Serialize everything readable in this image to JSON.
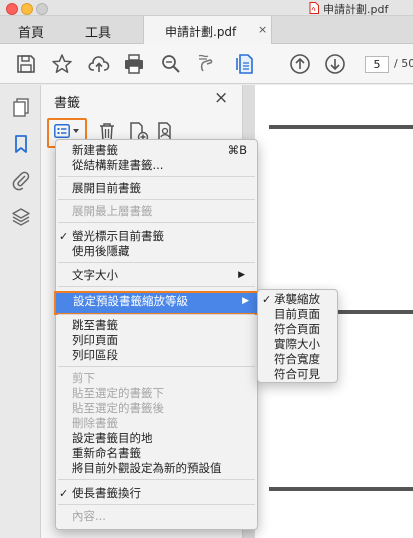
{
  "window": {
    "doc_title": "申請計劃.pdf"
  },
  "tabs": {
    "home": "首頁",
    "tools": "工具",
    "document": "申請計劃.pdf",
    "close": "×"
  },
  "toolbar": {
    "page_current": "5",
    "page_total": "/ 50"
  },
  "panel": {
    "title": "書籤",
    "close": "×"
  },
  "menu": {
    "new_bookmark": "新建書籤",
    "new_bookmark_shortcut": "⌘B",
    "new_from_structure": "從結構新建書籤...",
    "expand_current": "展開目前書籤",
    "expand_top_level": "展開最上層書籤",
    "highlight_current": "螢光標示目前書籤",
    "hide_after_use": "使用後隱藏",
    "text_size": "文字大小",
    "default_zoom": "設定預設書籤縮放等級",
    "goto": "跳至書籤",
    "print_pages": "列印頁面",
    "print_sections": "列印區段",
    "cut": "剪下",
    "paste_under": "貼至選定的書籤下",
    "paste_after": "貼至選定的書籤後",
    "delete": "刪除書籤",
    "set_destination": "設定書籤目的地",
    "rename": "重新命名書籤",
    "set_appearance_default": "將目前外觀設定為新的預設值",
    "wrap_long": "使長書籤換行",
    "properties": "內容...",
    "check": "✓",
    "arrow": "▶"
  },
  "submenu": {
    "items": [
      "承襲縮放",
      "目前頁面",
      "符合頁面",
      "實際大小",
      "符合寬度",
      "符合可見"
    ]
  },
  "colors": {
    "accent": "#4a86e8",
    "highlight_border": "#ef7d22",
    "icon_blue": "#2a6fd6",
    "pdf_red": "#d9261c"
  }
}
